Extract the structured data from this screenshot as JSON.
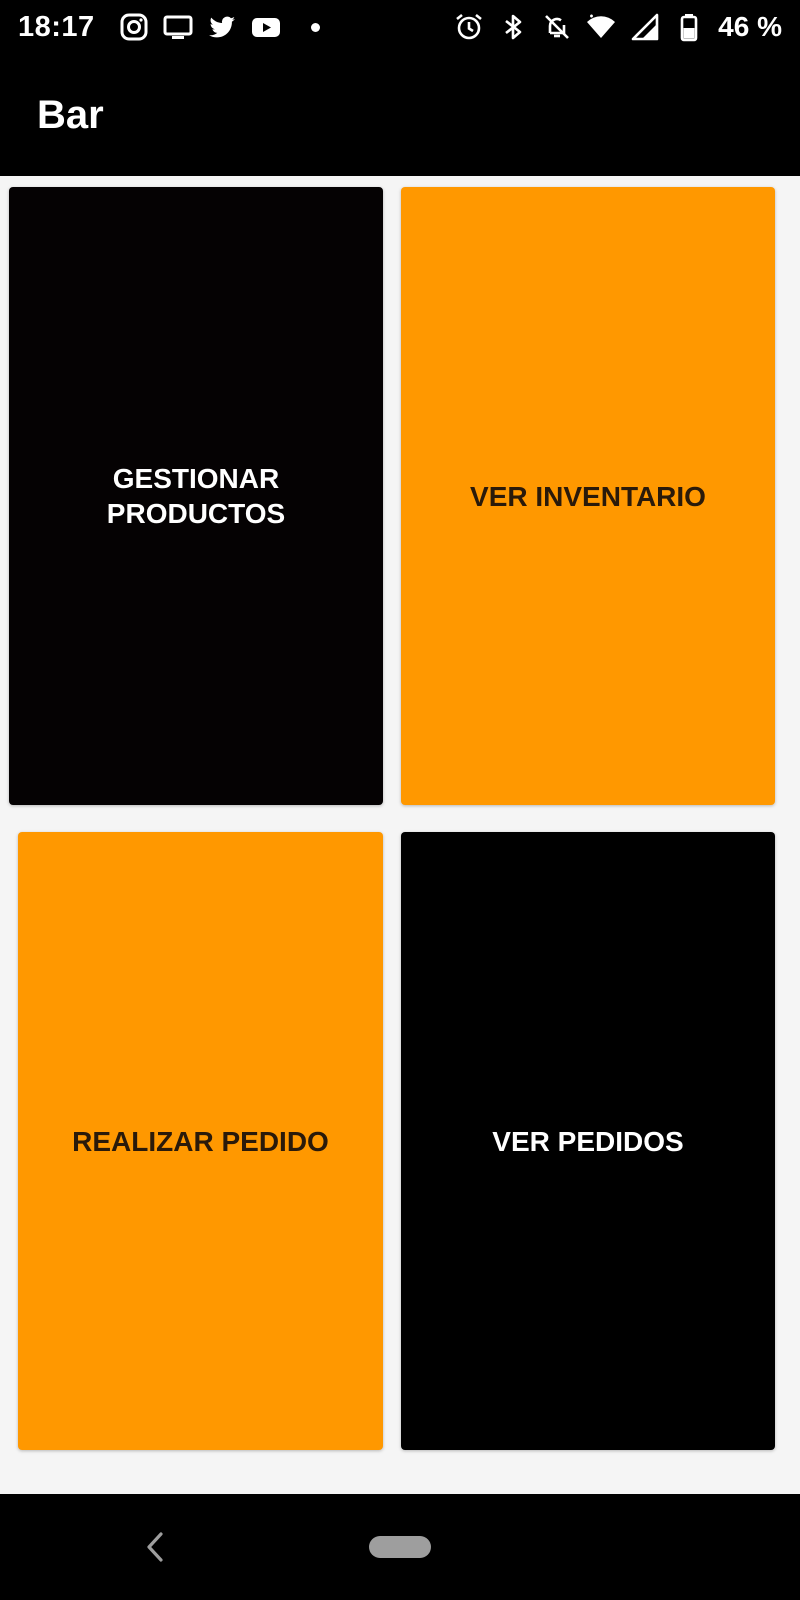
{
  "status_bar": {
    "time": "18:17",
    "battery": "46 %",
    "left_icons": [
      "instagram-icon",
      "tv-icon",
      "twitter-icon",
      "youtube-icon",
      "notification-dot"
    ],
    "right_icons": [
      "alarm-icon",
      "bluetooth-icon",
      "notifications-off-icon",
      "wifi-icon",
      "signal-icon",
      "battery-icon"
    ]
  },
  "app_bar": {
    "title": "Bar"
  },
  "tiles": [
    {
      "label": "GESTIONAR\nPRODUCTOS",
      "color": "#050203"
    },
    {
      "label": "VER INVENTARIO",
      "color": "#ff9800"
    },
    {
      "label": "REALIZAR PEDIDO",
      "color": "#ff9800"
    },
    {
      "label": "VER PEDIDOS",
      "color": "#000000"
    }
  ],
  "colors": {
    "accent_orange": "#ff9800",
    "tile_dark": "#050203",
    "background": "#f5f5f5"
  },
  "nav_bar": {
    "icons": [
      "back-icon",
      "home-pill"
    ]
  }
}
